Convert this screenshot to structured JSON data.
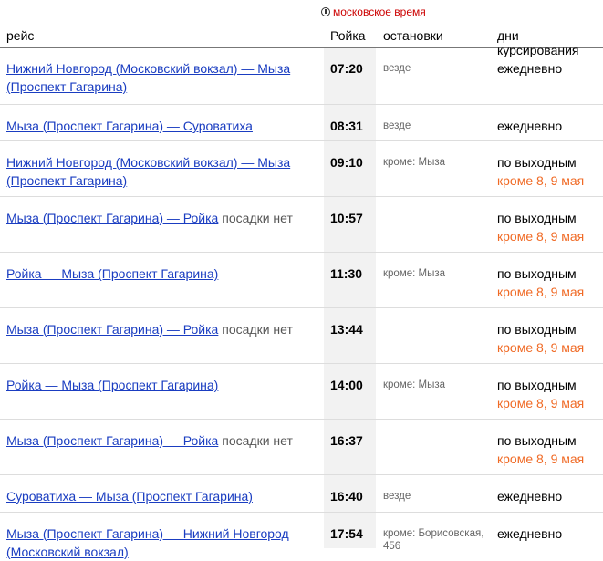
{
  "timezone_label": "московское время",
  "header": {
    "route": "рейс",
    "station": "Ройка",
    "stops": "остановки",
    "days": "дни курсирования"
  },
  "rows": [
    {
      "route": "Нижний Новгород (Московский вокзал) — Мыза (Проспект Гагарина)",
      "note": "",
      "time": "07:20",
      "stops": "везде",
      "days": "ежедневно",
      "except": ""
    },
    {
      "route": "Мыза (Проспект Гагарина) — Суроватиха",
      "note": "",
      "time": "08:31",
      "stops": "везде",
      "days": "ежедневно",
      "except": ""
    },
    {
      "route": "Нижний Новгород (Московский вокзал) — Мыза (Проспект Гагарина)",
      "note": "",
      "time": "09:10",
      "stops": "кроме: Мыза",
      "days": "по выходным",
      "except": "кроме 8, 9 мая"
    },
    {
      "route": "Мыза (Проспект Гагарина) — Ройка",
      "note": "посадки нет",
      "time": "10:57",
      "stops": "",
      "days": "по выходным",
      "except": "кроме 8, 9 мая"
    },
    {
      "route": "Ройка — Мыза (Проспект Гагарина)",
      "note": "",
      "time": "11:30",
      "stops": "кроме: Мыза",
      "days": "по выходным",
      "except": "кроме 8, 9 мая"
    },
    {
      "route": "Мыза (Проспект Гагарина) — Ройка",
      "note": "посадки нет",
      "time": "13:44",
      "stops": "",
      "days": "по выходным",
      "except": "кроме 8, 9 мая"
    },
    {
      "route": "Ройка — Мыза (Проспект Гагарина)",
      "note": "",
      "time": "14:00",
      "stops": "кроме: Мыза",
      "days": "по выходным",
      "except": "кроме 8, 9 мая"
    },
    {
      "route": "Мыза (Проспект Гагарина) — Ройка",
      "note": "посадки нет",
      "time": "16:37",
      "stops": "",
      "days": "по выходным",
      "except": "кроме 8, 9 мая"
    },
    {
      "route": "Суроватиха — Мыза (Проспект Гагарина)",
      "note": "",
      "time": "16:40",
      "stops": "везде",
      "days": "ежедневно",
      "except": ""
    },
    {
      "route": "Мыза (Проспект Гагарина) — Нижний Новгород (Московский вокзал)",
      "note": "",
      "time": "17:54",
      "stops": "кроме: Борисовская, 456",
      "days": "ежедневно",
      "except": ""
    }
  ]
}
